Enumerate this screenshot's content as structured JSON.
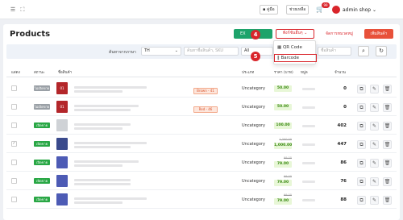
{
  "topbar": {
    "menu_icon": "hamburger-icon",
    "expand_icon": "fullscreen-icon",
    "btn_manual": "คู่มือ",
    "btn_help": "ช่วยเหลือ",
    "cart_count": "99",
    "user_name": "admin shop"
  },
  "header": {
    "title": "Products",
    "btn_excel": "EX",
    "btn_more": "ฟังก์ชันอื่นๆ",
    "btn_manage": "จัดการหมวดหมู่",
    "btn_add": "เพิ่มสินค้า"
  },
  "dropdown": {
    "qr_label": "QR Code",
    "barcode_label": "Barcode"
  },
  "steps": {
    "four": "4",
    "five": "5"
  },
  "filter": {
    "label": "ค้นหาจากภาษา",
    "lang_value": "TH",
    "search_placeholder": "ค้นหาชื่อสินค้า, SKU",
    "category_value": "All",
    "product_placeholder": "ชื่อสินค้า"
  },
  "table": {
    "headers": [
      "แสดง",
      "สถานะ",
      "ชื่อสินค้า",
      "ประเภท",
      "ราคา (บาท)",
      "หมู่ล",
      "จำนวน"
    ],
    "rows": [
      {
        "status": "ไม่เปิดขาย",
        "thumb": "01",
        "variant": "Brown - 41",
        "category": "Uncategory",
        "old_price": "",
        "price": "50.00",
        "qty": "0",
        "checked": false
      },
      {
        "status": "ไม่เปิดขาย",
        "thumb": "01",
        "variant": "Red - 46",
        "category": "Uncategory",
        "old_price": "",
        "price": "50.00",
        "qty": "0",
        "checked": false
      },
      {
        "status": "เปิดขาย",
        "thumb": "",
        "variant": "",
        "category": "Uncategory",
        "old_price": "",
        "price": "100.00",
        "qty": "402",
        "checked": false
      },
      {
        "status": "เปิดขาย",
        "thumb": "",
        "variant": "",
        "category": "Uncategory",
        "old_price": "1,200.00",
        "price": "1,000.00",
        "qty": "447",
        "checked": true
      },
      {
        "status": "เปิดขาย",
        "thumb": "",
        "variant": "",
        "category": "Uncategory",
        "old_price": "99.00",
        "price": "79.00",
        "qty": "86",
        "checked": false
      },
      {
        "status": "เปิดขาย",
        "thumb": "",
        "variant": "",
        "category": "Uncategory",
        "old_price": "99.00",
        "price": "79.00",
        "qty": "76",
        "checked": false
      },
      {
        "status": "เปิดขาย",
        "thumb": "",
        "variant": "",
        "category": "Uncategory",
        "old_price": "99.00",
        "price": "79.00",
        "qty": "88",
        "checked": false
      }
    ]
  },
  "colors": {
    "accent": "#d9252b",
    "excel": "#1da36b",
    "status_off": "#9aa0a6",
    "status_on": "#29a745",
    "price_bg": "#e8f7d7"
  }
}
